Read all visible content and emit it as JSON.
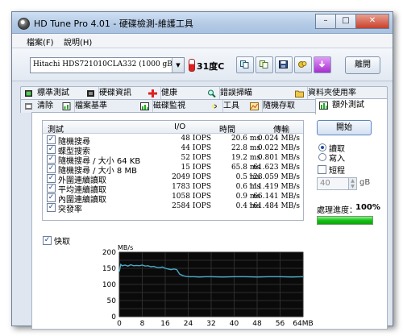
{
  "window": {
    "title": "HD Tune Pro 4.01 - 硬碟檢測-維護工具",
    "minimize": "–",
    "maximize": "□",
    "close": "✕"
  },
  "menu": {
    "file": "檔案(F)",
    "help": "說明(H)"
  },
  "toolbar": {
    "drive": "Hitachi HDS721010CLA332 (1000 gB)",
    "temperature": "31度C",
    "exit_label": "離開",
    "buttons": [
      "copy-info-icon",
      "copy-screen-icon",
      "save-icon",
      "options-icon",
      "download-icon"
    ]
  },
  "tabs_top": [
    {
      "label": "標準測試",
      "icon": "benchmark-icon"
    },
    {
      "label": "硬碟資訊",
      "icon": "info-icon"
    },
    {
      "label": "健康",
      "icon": "health-icon"
    },
    {
      "label": "錯誤掃瞄",
      "icon": "error-scan-icon"
    },
    {
      "label": "資料夾使用率",
      "icon": "folder-usage-icon"
    }
  ],
  "tabs_bottom": [
    {
      "label": "清除",
      "icon": "erase-icon"
    },
    {
      "label": "檔案基準",
      "icon": "file-benchmark-icon"
    },
    {
      "label": "磁碟監視",
      "icon": "disk-monitor-icon"
    },
    {
      "label": "工具",
      "icon": "tools-icon"
    },
    {
      "label": "隨機存取",
      "icon": "random-access-icon"
    },
    {
      "label": "額外測試",
      "icon": "extra-tests-icon",
      "active": true
    }
  ],
  "results": {
    "headers": {
      "test": "測試",
      "io": "I/O",
      "time": "時間",
      "transfer": "傳輸"
    },
    "rows": [
      {
        "name": "隨機搜尋",
        "io": "48 IOPS",
        "time": "20.6 ms",
        "transfer": "0.024 MB/s",
        "checked": true
      },
      {
        "name": "蝶型搜索",
        "io": "44 IOPS",
        "time": "22.8 ms",
        "transfer": "0.022 MB/s",
        "checked": true
      },
      {
        "name": "隨機搜尋 / 大小 64 KB",
        "io": "52 IOPS",
        "time": "19.2 ms",
        "transfer": "0.801 MB/s",
        "checked": true
      },
      {
        "name": "隨機搜尋 / 大小 8 MB",
        "io": "15 IOPS",
        "time": "65.8 ms",
        "transfer": "61.623 MB/s",
        "checked": true
      },
      {
        "name": "外圍連續讀取",
        "io": "2049 IOPS",
        "time": "0.5 ms",
        "transfer": "128.059 MB/s",
        "checked": true
      },
      {
        "name": "平均連續讀取",
        "io": "1783 IOPS",
        "time": "0.6 ms",
        "transfer": "111.419 MB/s",
        "checked": true
      },
      {
        "name": "內圍連續讀取",
        "io": "1058 IOPS",
        "time": "0.9 ms",
        "transfer": "66.141 MB/s",
        "checked": true
      },
      {
        "name": "突發率",
        "io": "2584 IOPS",
        "time": "0.4 ms",
        "transfer": "161.484 MB/s",
        "checked": true
      }
    ]
  },
  "controls": {
    "start_label": "開始",
    "read_label": "讀取",
    "write_label": "寫入",
    "short_label": "短程",
    "short_value": "40",
    "short_unit": "gB",
    "progress_label": "處理進度：",
    "progress_value": "100%",
    "progress_fraction": 1.0,
    "fast_label": "快取",
    "check_mark": "✓"
  },
  "chart_data": {
    "type": "line",
    "ylabel": "MB/s",
    "xlabel": "MB",
    "ylim": [
      0,
      200
    ],
    "xlim": [
      0,
      64
    ],
    "yticks": [
      0,
      25,
      50,
      75,
      100,
      125,
      150,
      175,
      200
    ],
    "xticks": [
      0,
      8,
      16,
      24,
      32,
      40,
      48,
      56,
      64
    ],
    "xtick_labels": [
      "0",
      "8",
      "16",
      "24",
      "32",
      "40",
      "48",
      "56",
      "64MB"
    ],
    "series": [
      {
        "color": "#4aa8c8",
        "x": [
          0,
          0.5,
          1,
          2,
          3,
          4,
          5,
          6,
          7,
          8,
          9,
          10,
          11,
          12,
          13,
          14,
          15,
          16,
          17,
          18,
          19,
          20,
          21,
          22,
          23,
          24,
          26,
          28,
          30,
          32,
          36,
          40,
          44,
          48,
          52,
          56,
          60,
          64
        ],
        "values": [
          140,
          162,
          158,
          160,
          157,
          161,
          158,
          159,
          158,
          160,
          157,
          158,
          155,
          156,
          153,
          152,
          154,
          150,
          148,
          146,
          148,
          146,
          132,
          128,
          125,
          124,
          124,
          123,
          124,
          124,
          123,
          124,
          124,
          123,
          124,
          124,
          123,
          124
        ]
      }
    ]
  }
}
